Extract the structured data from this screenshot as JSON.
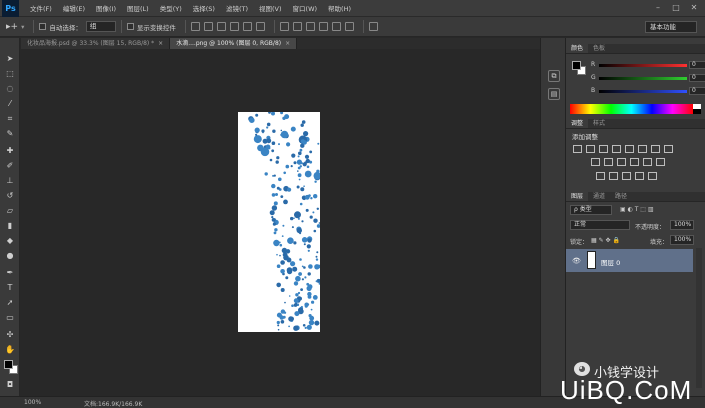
{
  "app": {
    "logo": "Ps"
  },
  "menu": [
    "文件(F)",
    "编辑(E)",
    "图像(I)",
    "图层(L)",
    "类型(Y)",
    "选择(S)",
    "滤镜(T)",
    "视图(V)",
    "窗口(W)",
    "帮助(H)"
  ],
  "window_controls": {
    "minimize": "–",
    "maximize": "□",
    "close": "✕"
  },
  "options": {
    "tool_icon": "move-tool-icon",
    "auto_select_label": "自动选择：",
    "auto_select_value": "组",
    "show_transform_label": "显示变换控件",
    "workspace": "基本功能"
  },
  "tabs": [
    {
      "label": "化妆品海报.psd @ 33.3% (图层 15, RGB/8) *",
      "close": "×"
    },
    {
      "label": "水滴....png @ 100% (图层 0, RGB/8)",
      "close": "×"
    }
  ],
  "status": {
    "zoom": "100%",
    "doc_size": "文档:166.9K/166.9K"
  },
  "panels": {
    "color_tabs": [
      "颜色",
      "色板"
    ],
    "sliders": [
      {
        "label": "R",
        "value": "0",
        "color": "#ff3030"
      },
      {
        "label": "G",
        "value": "0",
        "color": "#30d030"
      },
      {
        "label": "B",
        "value": "0",
        "color": "#3050ff"
      }
    ],
    "adjust_tabs": [
      "调整",
      "样式"
    ],
    "adjust_title": "添加调整",
    "layers_tabs": [
      "图层",
      "通道",
      "路径"
    ],
    "kind_select": "ρ 类型",
    "blend_mode": "正常",
    "opacity_label": "不透明度：",
    "opacity_value": "100%",
    "lock_label": "锁定：",
    "fill_label": "填充：",
    "fill_value": "100%",
    "layer_name": "图层 0"
  },
  "watermark": {
    "name": "小钱学设计",
    "site": "UiBQ.CoM"
  },
  "colors": {
    "accent_layer": "#60708a",
    "drop_blue": "#3a84c4",
    "bg": "#282828"
  }
}
